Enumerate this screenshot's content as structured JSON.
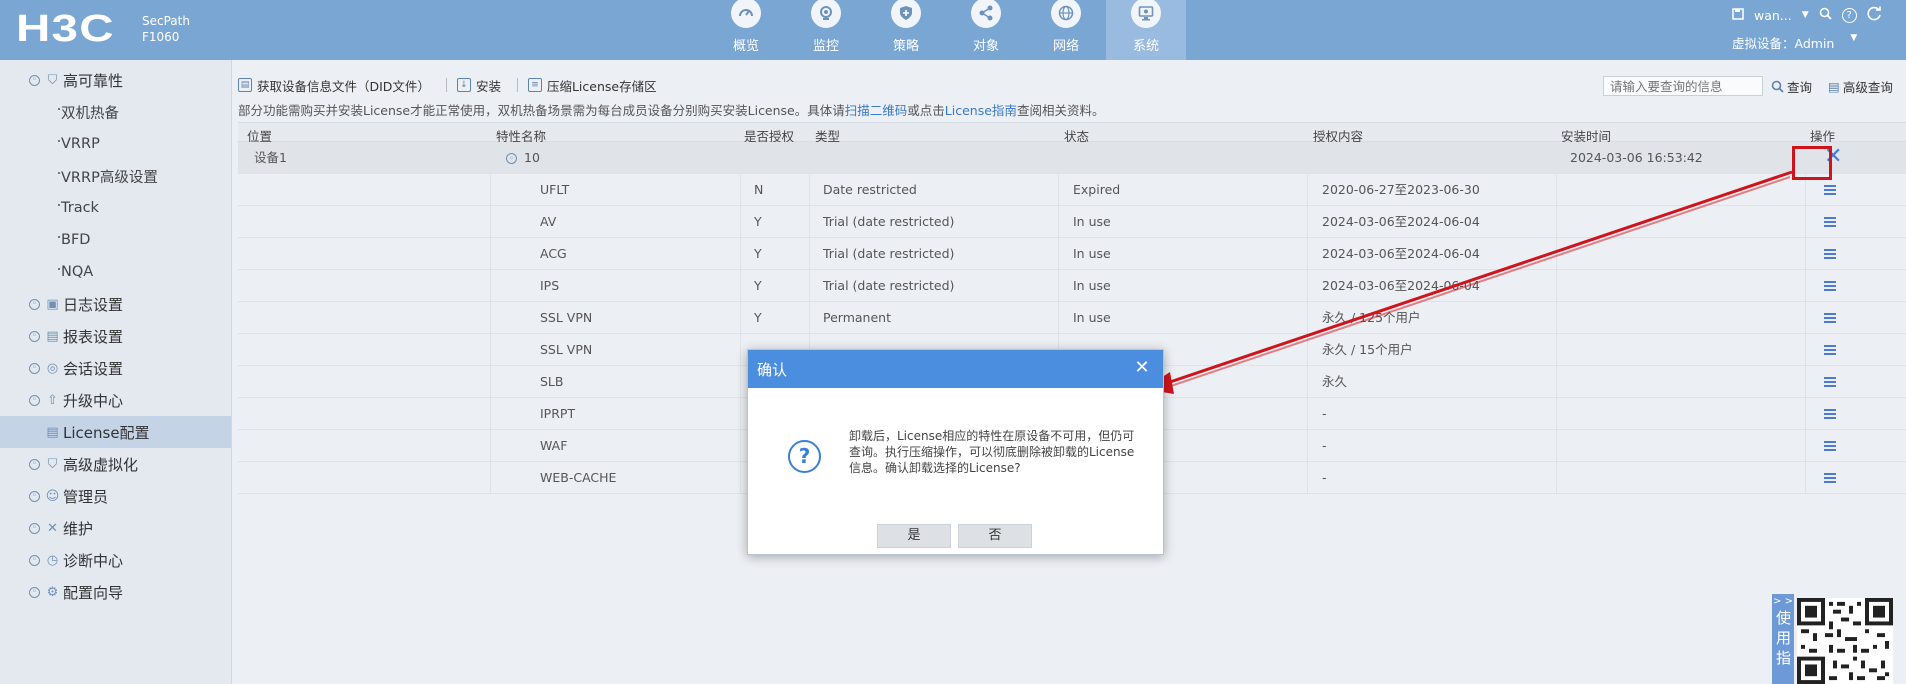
{
  "header": {
    "logo": "H3C",
    "product_line1": "SecPath",
    "product_line2": "F1060",
    "tabs": [
      {
        "label": "概览",
        "icon": "gauge-icon"
      },
      {
        "label": "监控",
        "icon": "monitor-icon"
      },
      {
        "label": "策略",
        "icon": "shield-icon"
      },
      {
        "label": "对象",
        "icon": "share-icon"
      },
      {
        "label": "网络",
        "icon": "globe-icon"
      },
      {
        "label": "系统",
        "icon": "system-icon"
      }
    ],
    "active_tab": "系统",
    "user": "wan...",
    "virtual_device": "虚拟设备：Admin"
  },
  "sidebar": {
    "items": [
      {
        "label": "高可靠性",
        "type": "group",
        "icon": "shield-small-icon"
      },
      {
        "label": "双机热备",
        "type": "sub"
      },
      {
        "label": "VRRP",
        "type": "sub"
      },
      {
        "label": "VRRP高级设置",
        "type": "sub"
      },
      {
        "label": "Track",
        "type": "sub"
      },
      {
        "label": "BFD",
        "type": "sub"
      },
      {
        "label": "NQA",
        "type": "sub"
      },
      {
        "label": "日志设置",
        "type": "group",
        "icon": "log-icon"
      },
      {
        "label": "报表设置",
        "type": "group",
        "icon": "report-icon"
      },
      {
        "label": "会话设置",
        "type": "group",
        "icon": "session-icon"
      },
      {
        "label": "升级中心",
        "type": "group",
        "icon": "upgrade-icon"
      },
      {
        "label": "License配置",
        "type": "active",
        "icon": "license-icon"
      },
      {
        "label": "高级虚拟化",
        "type": "group",
        "icon": "virtualization-icon"
      },
      {
        "label": "管理员",
        "type": "group",
        "icon": "admin-icon"
      },
      {
        "label": "维护",
        "type": "group",
        "icon": "tools-icon"
      },
      {
        "label": "诊断中心",
        "type": "group",
        "icon": "diagnosis-icon"
      },
      {
        "label": "配置向导",
        "type": "group",
        "icon": "wizard-icon"
      }
    ]
  },
  "toolbar": {
    "get_did": "获取设备信息文件（DID文件）",
    "install": "安装",
    "compress": "压缩License存储区",
    "search_placeholder": "请输入要查询的信息",
    "query": "查询",
    "advanced_query": "高级查询"
  },
  "notice": {
    "part1": "部分功能需购买并安装License才能正常使用，双机热备场景需为每台成员设备分别购买安装License。具体请",
    "link1": "扫描二维码",
    "part2": "或点击",
    "link2": "License指南",
    "part3": "查阅相关资料。"
  },
  "table": {
    "columns": [
      "位置",
      "特性名称",
      "是否授权",
      "类型",
      "状态",
      "授权内容",
      "安装时间",
      "操作"
    ],
    "parent": {
      "location": "设备1",
      "count": "10",
      "install_time": "2024-03-06 16:53:42"
    },
    "rows": [
      {
        "name": "UFLT",
        "auth": "N",
        "type": "Date restricted",
        "status": "Expired",
        "content": "2020-06-27至2023-06-30"
      },
      {
        "name": "AV",
        "auth": "Y",
        "type": "Trial (date restricted)",
        "status": "In use",
        "content": "2024-03-06至2024-06-04"
      },
      {
        "name": "ACG",
        "auth": "Y",
        "type": "Trial (date restricted)",
        "status": "In use",
        "content": "2024-03-06至2024-06-04"
      },
      {
        "name": "IPS",
        "auth": "Y",
        "type": "Trial (date restricted)",
        "status": "In use",
        "content": "2024-03-06至2024-06-04"
      },
      {
        "name": "SSL VPN",
        "auth": "Y",
        "type": "Permanent",
        "status": "In use",
        "content": "永久 / 125个用户"
      },
      {
        "name": "SSL VPN",
        "auth": "",
        "type": "",
        "status": "",
        "content": "永久 / 15个用户"
      },
      {
        "name": "SLB",
        "auth": "",
        "type": "",
        "status": "",
        "content": "永久"
      },
      {
        "name": "IPRPT",
        "auth": "",
        "type": "",
        "status": "",
        "content": "-"
      },
      {
        "name": "WAF",
        "auth": "",
        "type": "",
        "status": "",
        "content": "-"
      },
      {
        "name": "WEB-CACHE",
        "auth": "",
        "type": "",
        "status": "",
        "content": "-"
      }
    ]
  },
  "modal": {
    "title": "确认",
    "message": "卸载后，License相应的特性在原设备不可用，但仍可查询。执行压缩操作，可以彻底删除被卸载的License信息。确认卸载选择的License?",
    "yes": "是",
    "no": "否"
  },
  "guide": {
    "arrows": "> >",
    "label": "使用指"
  },
  "colors": {
    "header_bg": "#7aa6d4",
    "modal_head": "#4b8ddf",
    "annotation_red": "#d0141c",
    "link": "#3a7ac7"
  }
}
